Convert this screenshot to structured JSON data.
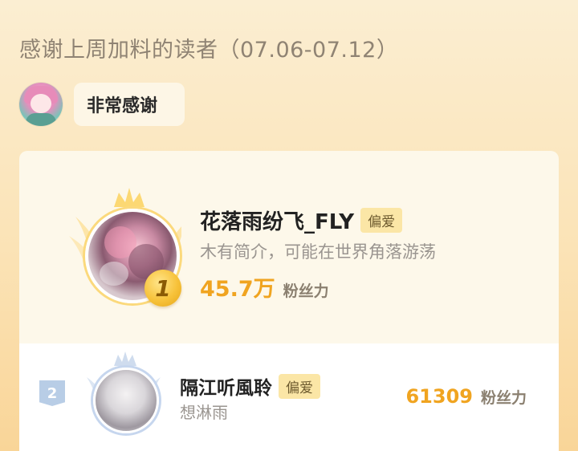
{
  "header": {
    "title": "感谢上周加料的读者（07.06-07.12）"
  },
  "host": {
    "bubble_text": "非常感谢",
    "avatar_icon": "anime-avatar-icon"
  },
  "ranking": [
    {
      "rank": "1",
      "name": "花落雨纷飞_FLY",
      "tag": "偏爱",
      "description": "木有简介，可能在世界角落游荡",
      "fans_count": "45.7万",
      "fans_label": "粉丝力",
      "badge_color": "#f7c23a",
      "crown_color": "#fbd97c"
    },
    {
      "rank": "2",
      "name": "隔江听風聆",
      "tag": "偏爱",
      "description": "想淋雨",
      "fans_count": "61309",
      "fans_label": "粉丝力",
      "badge_color": "#b8cde6",
      "crown_color": "#c6d6ee"
    }
  ],
  "colors": {
    "accent": "#f0a420",
    "tag_bg": "#fbe6a6",
    "background": "#fbe3b6"
  }
}
